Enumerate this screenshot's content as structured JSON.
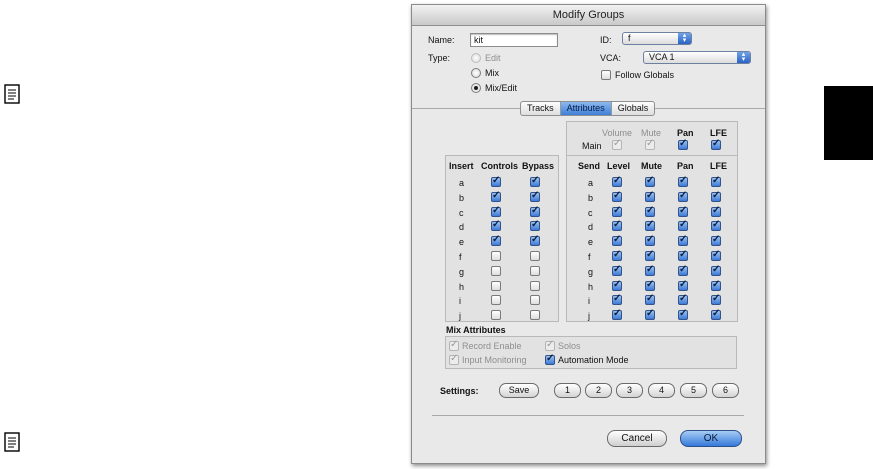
{
  "dialog": {
    "title": "Modify Groups",
    "name_label": "Name:",
    "name_value": "kit",
    "id_label": "ID:",
    "id_value": "f",
    "type_label": "Type:",
    "type_options": [
      "Edit",
      "Mix",
      "Mix/Edit"
    ],
    "type_selected": "Mix/Edit",
    "vca_label": "VCA:",
    "vca_value": "VCA 1",
    "follow_globals_label": "Follow Globals",
    "tabs": [
      "Tracks",
      "Attributes",
      "Globals"
    ],
    "active_tab": "Attributes"
  },
  "inserts": {
    "headers": [
      "Insert",
      "Controls",
      "Bypass"
    ],
    "rows": [
      {
        "label": "a",
        "controls": true,
        "bypass": true
      },
      {
        "label": "b",
        "controls": true,
        "bypass": true
      },
      {
        "label": "c",
        "controls": true,
        "bypass": true
      },
      {
        "label": "d",
        "controls": true,
        "bypass": true
      },
      {
        "label": "e",
        "controls": true,
        "bypass": true
      },
      {
        "label": "f",
        "controls": false,
        "bypass": false
      },
      {
        "label": "g",
        "controls": false,
        "bypass": false
      },
      {
        "label": "h",
        "controls": false,
        "bypass": false
      },
      {
        "label": "i",
        "controls": false,
        "bypass": false
      },
      {
        "label": "j",
        "controls": false,
        "bypass": false
      }
    ]
  },
  "main": {
    "headers": [
      "Volume",
      "Mute",
      "Pan",
      "LFE"
    ],
    "label": "Main"
  },
  "sends": {
    "headers": [
      "Send",
      "Level",
      "Mute",
      "Pan",
      "LFE"
    ],
    "rows": [
      "a",
      "b",
      "c",
      "d",
      "e",
      "f",
      "g",
      "h",
      "i",
      "j"
    ]
  },
  "mix_attributes": {
    "title": "Mix Attributes",
    "record_enable": "Record Enable",
    "solos": "Solos",
    "input_monitoring": "Input Monitoring",
    "automation_mode": "Automation Mode"
  },
  "settings": {
    "label": "Settings:",
    "buttons": [
      "Save",
      "1",
      "2",
      "3",
      "4",
      "5",
      "6"
    ]
  },
  "actions": {
    "cancel": "Cancel",
    "ok": "OK"
  }
}
